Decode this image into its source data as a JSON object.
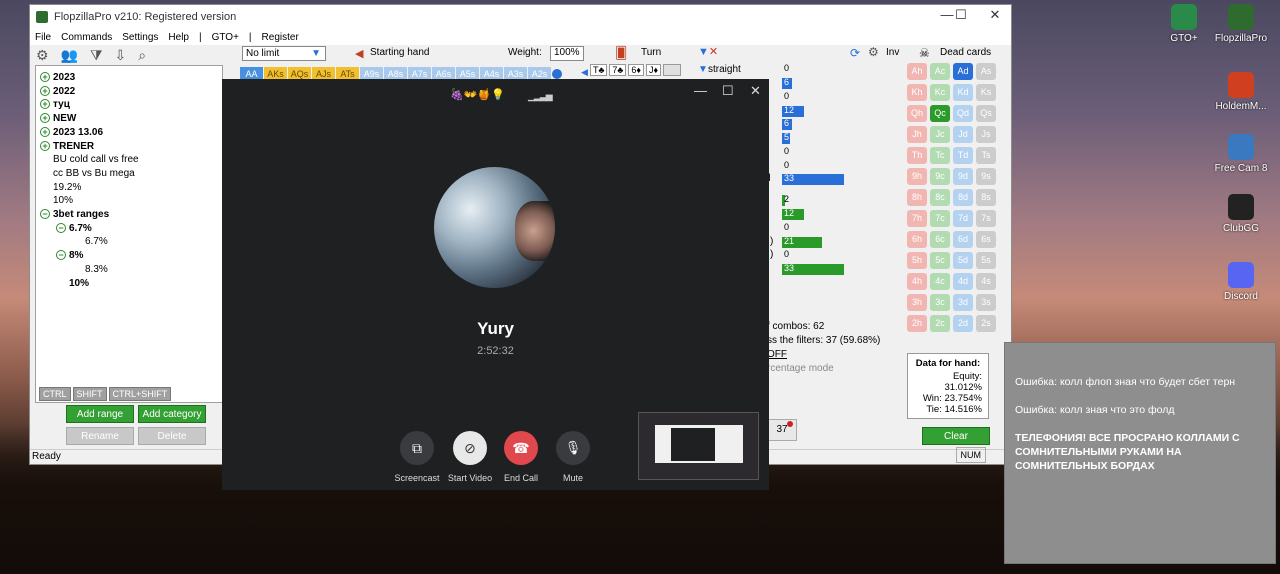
{
  "app": {
    "title": "FlopzillaPro v210: Registered version",
    "menu": [
      "File",
      "Commands",
      "Settings",
      "Help",
      "|",
      "GTO+",
      "|",
      "Register"
    ],
    "range_select": "No limit",
    "starting_hand": "Starting hand",
    "weight_label": "Weight:",
    "weight_value": "100%",
    "turn_label": "Turn",
    "inv_label": "Inv",
    "dead_cards_label": "Dead cards",
    "straight_label": "straight",
    "tree": [
      {
        "label": "2023",
        "bold": true,
        "icon": "plus"
      },
      {
        "label": "2022",
        "bold": true,
        "icon": "plus"
      },
      {
        "label": "туц",
        "bold": true,
        "icon": "plus"
      },
      {
        "label": "NEW",
        "bold": true,
        "icon": "plus"
      },
      {
        "label": "2023 13.06",
        "bold": true,
        "icon": "plus"
      },
      {
        "label": "TRENER",
        "bold": true,
        "icon": "plus"
      },
      {
        "label": "BU cold call vs free",
        "bold": false
      },
      {
        "label": "cc BB vs Bu mega",
        "bold": false
      },
      {
        "label": "19.2%",
        "bold": false
      },
      {
        "label": "10%",
        "bold": false
      },
      {
        "label": "3bet ranges",
        "bold": true,
        "icon": "minus"
      },
      {
        "label": "6.7%",
        "bold": true,
        "icon": "minus"
      },
      {
        "label": "6.7%",
        "bold": false
      },
      {
        "label": "8%",
        "bold": true,
        "icon": "minus"
      },
      {
        "label": "8.3%",
        "bold": false
      },
      {
        "label": "10%",
        "bold": true
      }
    ],
    "keys": [
      "CTRL",
      "SHIFT",
      "CTRL+SHIFT"
    ],
    "buttons": {
      "add_range": "Add range",
      "add_category": "Add category",
      "rename": "Rename",
      "delete": "Delete",
      "clear": "Clear"
    },
    "hand_row": [
      "AA",
      "AKs",
      "AQs",
      "AJs",
      "ATs",
      "A9s",
      "A8s",
      "A7s",
      "A6s",
      "A5s",
      "A4s",
      "A3s",
      "A2s"
    ],
    "board": [
      "T♣",
      "7♣",
      "6♦",
      "J♦"
    ],
    "stats": [
      {
        "v": "0",
        "w": 0,
        "c": "#2a6ed8"
      },
      {
        "v": "6",
        "w": 10,
        "c": "#2a6ed8"
      },
      {
        "v": "0",
        "w": 0,
        "c": "#2a6ed8"
      },
      {
        "v": "12",
        "w": 22,
        "c": "#2a6ed8"
      },
      {
        "v": "6",
        "w": 10,
        "c": "#2a6ed8"
      },
      {
        "v": "5",
        "w": 8,
        "c": "#2a6ed8"
      },
      {
        "v": "0",
        "w": 0,
        "c": "#2a6ed8"
      },
      {
        "v": "0",
        "w": 0,
        "c": "#2a6ed8"
      },
      {
        "v": "33",
        "w": 62,
        "c": "#2a6ed8"
      },
      {
        "v": "2",
        "w": 3,
        "c": "#2a9a2a"
      },
      {
        "v": "12",
        "w": 22,
        "c": "#2a9a2a"
      },
      {
        "v": "0",
        "w": 0,
        "c": "#2a9a2a"
      },
      {
        "v": "21",
        "w": 40,
        "c": "#2a9a2a"
      },
      {
        "v": "0",
        "w": 0,
        "c": "#2a9a2a"
      },
      {
        "v": "33",
        "w": 62,
        "c": "#2a9a2a"
      }
    ],
    "stat_suffix": [
      "d",
      ")",
      ")"
    ],
    "combos_text": "f combos: 62",
    "filter_text": "ss the filters: 37 (59.68%)",
    "off_text": "OFF",
    "pct_mode": "rcentage mode",
    "count37": "37",
    "hand_info": {
      "title": "Data for hand:",
      "equity": "Equity: 31.012%",
      "win": "Win: 23.754%",
      "tie": "Tie: 14.516%"
    },
    "dead_cards": [
      "Ah",
      "Ac",
      "Ad",
      "As",
      "Kh",
      "Kc",
      "Kd",
      "Ks",
      "Qh",
      "Qc",
      "Qd",
      "Qs",
      "Jh",
      "Jc",
      "Jd",
      "Js",
      "Th",
      "Tc",
      "Td",
      "Ts",
      "9h",
      "9c",
      "9d",
      "9s",
      "8h",
      "8c",
      "8d",
      "8s",
      "7h",
      "7c",
      "7d",
      "7s",
      "6h",
      "6c",
      "6d",
      "6s",
      "5h",
      "5c",
      "5d",
      "5s",
      "4h",
      "4c",
      "4d",
      "4s",
      "3h",
      "3c",
      "3d",
      "3s",
      "2h",
      "2c",
      "2d",
      "2s"
    ],
    "status": "Ready",
    "num": "NUM"
  },
  "call": {
    "emoji": "🍇👐🍯💡",
    "name": "Yury",
    "time": "2:52:32",
    "buttons": [
      "Screencast",
      "Start Video",
      "End Call",
      "Mute"
    ]
  },
  "desktop": [
    {
      "label": "GTO+",
      "color": "#2a8a4a"
    },
    {
      "label": "FlopzillaPro",
      "color": "#2f6b2f"
    },
    {
      "label": "HoldemM...",
      "color": "#d04020"
    },
    {
      "label": "Free Cam 8",
      "color": "#3a78c0"
    },
    {
      "label": "ClubGG",
      "color": "#222"
    },
    {
      "label": "Discord",
      "color": "#5865f2"
    }
  ],
  "notification": {
    "line1": "Ошибка: колл флоп зная что будет сбет терн",
    "line2": "Ошибка: колл зная что это фолд",
    "line3": "ТЕЛЕФОНИЯ! ВСЕ ПРОСРАНО КОЛЛАМИ С СОМНИТЕЛЬНЫМИ РУКАМИ НА СОМНИТЕЛЬНЫХ БОРДАХ"
  }
}
